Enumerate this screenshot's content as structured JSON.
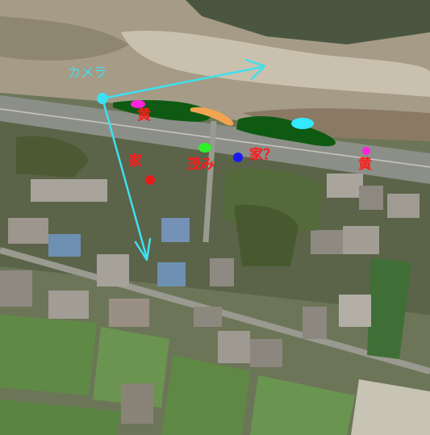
{
  "labels": {
    "camera": "カメラ",
    "yellow_left": "黄",
    "yellow_right": "黄",
    "house": "家",
    "house_question": "家？",
    "bushes": "茂み"
  },
  "colors": {
    "camera_marker": "#3ee0f0",
    "view_lines": "#3ee0f0",
    "camera_text": "#3ee0f0",
    "annotation_text": "#ff1a1a",
    "hedge": "#0f5a12",
    "magenta_marker": "#ff22dd",
    "orange_marker": "#f4a450",
    "cyan_marker": "#33e8ff",
    "green_marker": "#2ef02a",
    "blue_marker": "#1a1aee",
    "red_marker": "#e61a1a"
  }
}
